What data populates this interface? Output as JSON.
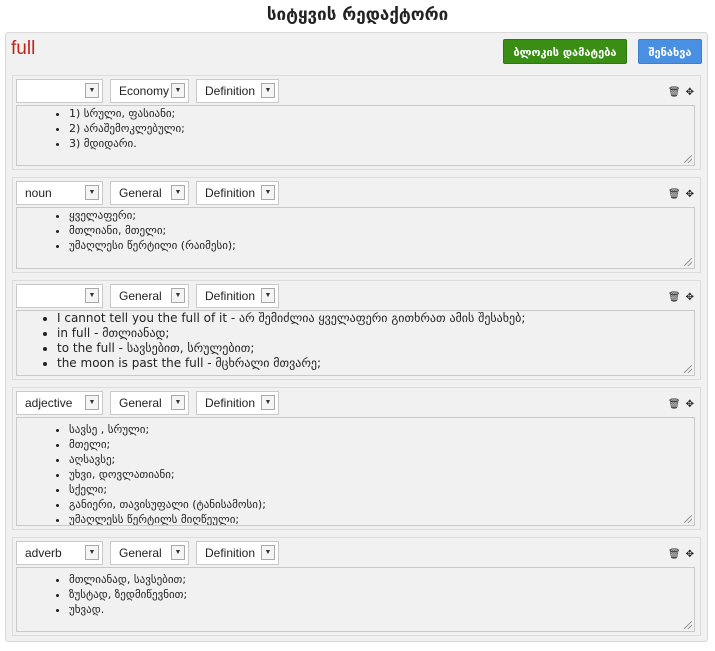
{
  "page": {
    "title": "სიტყვის რედაქტორი"
  },
  "editor": {
    "word": "full",
    "add_block_label": "ბლოკის დამატება",
    "save_label": "შენახვა",
    "tool_icons": {
      "delete": "trash-icon",
      "move": "move-icon"
    },
    "colors": {
      "word": "#c0241b",
      "add_button": "#3a8e14",
      "save_button": "#4a90e2"
    },
    "blocks": [
      {
        "type": "",
        "field": "Economy",
        "kind": "Definition",
        "items": [
          "1) სრული, ფასიანი;",
          "2) არაშემოკლებული;",
          "3) მდიდარი."
        ]
      },
      {
        "type": "noun",
        "field": "General",
        "kind": "Definition",
        "items": [
          "ყველაფერი;",
          "მთლიანი, მთელი;",
          "უმაღლესი წერტილი (რაიმესი);"
        ]
      },
      {
        "type": "",
        "field": "General",
        "kind": "Definition",
        "items": [
          "I cannot tell you the full of it - არ შემიძლია ყველაფერი გითხრათ ამის შესახებ;",
          "in full - მთლიანად;",
          "to the full - სავსებით, სრულებით;",
          "the moon is past the full - მცხრალი მთვარე;"
        ]
      },
      {
        "type": "adjective",
        "field": "General",
        "kind": "Definition",
        "items": [
          "სავსე , სრული;",
          "მთელი;",
          "აღსავსე;",
          "უხვი, დოვლათიანი;",
          "სქელი;",
          "განიერი, თავისუფალი (ტანისამოსი);",
          "უმაღლესს წერტილს მიღწეული;"
        ]
      },
      {
        "type": "adverb",
        "field": "General",
        "kind": "Definition",
        "items": [
          "მთლიანად, სავსებით;",
          "ზუსტად, ზედმიწევნით;",
          "უხვად."
        ]
      }
    ]
  }
}
